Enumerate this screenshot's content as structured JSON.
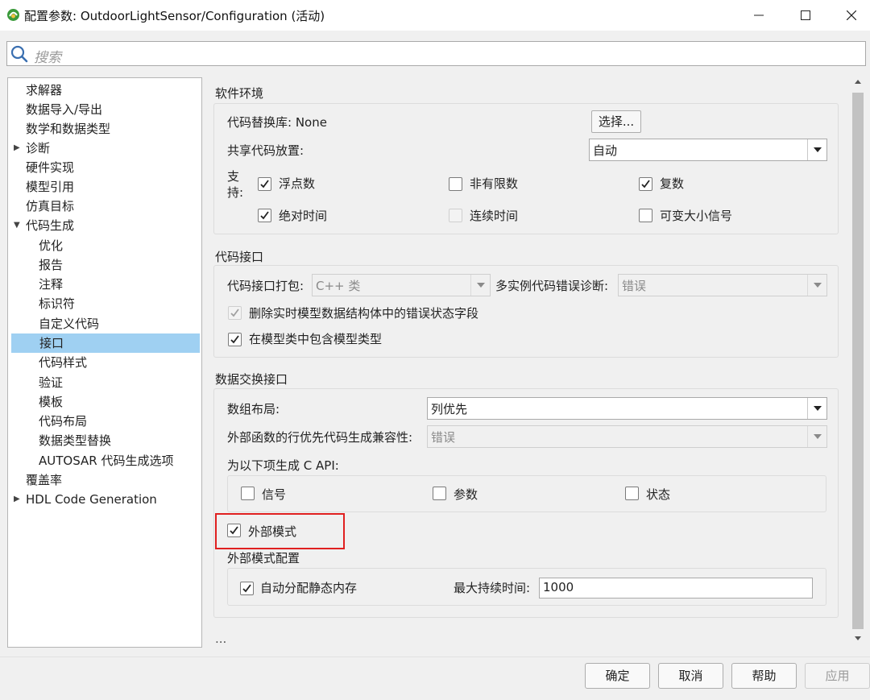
{
  "window": {
    "title": "配置参数: OutdoorLightSensor/Configuration (活动)"
  },
  "search": {
    "placeholder": "搜索"
  },
  "tree": {
    "items": [
      {
        "label": "求解器"
      },
      {
        "label": "数据导入/导出"
      },
      {
        "label": "数学和数据类型"
      },
      {
        "label": "诊断",
        "expand": "collapsed"
      },
      {
        "label": "硬件实现"
      },
      {
        "label": "模型引用"
      },
      {
        "label": "仿真目标"
      },
      {
        "label": "代码生成",
        "expand": "expanded"
      },
      {
        "label": "优化"
      },
      {
        "label": "报告"
      },
      {
        "label": "注释"
      },
      {
        "label": "标识符"
      },
      {
        "label": "自定义代码"
      },
      {
        "label": "接口",
        "selected": true
      },
      {
        "label": "代码样式"
      },
      {
        "label": "验证"
      },
      {
        "label": "模板"
      },
      {
        "label": "代码布局"
      },
      {
        "label": "数据类型替换"
      },
      {
        "label": "AUTOSAR 代码生成选项"
      },
      {
        "label": "覆盖率"
      },
      {
        "label": "HDL Code Generation",
        "expand": "collapsed"
      }
    ]
  },
  "software_env": {
    "title": "软件环境",
    "code_replacement_label": "代码替换库: None",
    "select_button": "选择...",
    "shared_code_label": "共享代码放置:",
    "shared_code_value": "自动",
    "support_label_1": "支",
    "support_label_2": "持:",
    "float_label": "浮点数",
    "float_checked": true,
    "nonfinite_label": "非有限数",
    "nonfinite_checked": false,
    "complex_label": "复数",
    "complex_checked": true,
    "abstime_label": "绝对时间",
    "abstime_checked": true,
    "conttime_label": "连续时间",
    "conttime_checked": false,
    "varsize_label": "可变大小信号",
    "varsize_checked": false
  },
  "code_interface": {
    "title": "代码接口",
    "packaging_label": "代码接口打包:",
    "packaging_value": "C++ 类",
    "multi_instance_label": "多实例代码错误诊断:",
    "multi_instance_value": "错误",
    "remove_error_label": "删除实时模型数据结构体中的错误状态字段",
    "remove_error_checked": true,
    "include_model_types_label": "在模型类中包含模型类型",
    "include_model_types_checked": true
  },
  "data_exchange": {
    "title": "数据交换接口",
    "array_layout_label": "数组布局:",
    "array_layout_value": "列优先",
    "row_major_label": "外部函数的行优先代码生成兼容性:",
    "row_major_value": "错误",
    "c_api_label": "为以下项生成 C API:",
    "signals_label": "信号",
    "signals_checked": false,
    "params_label": "参数",
    "params_checked": false,
    "states_label": "状态",
    "states_checked": false,
    "external_mode_label": "外部模式",
    "external_mode_checked": true,
    "ext_config_title": "外部模式配置",
    "static_mem_label": "自动分配静态内存",
    "static_mem_checked": true,
    "max_duration_label": "最大持续时间:",
    "max_duration_value": "1000"
  },
  "more": "...",
  "buttons": {
    "ok": "确定",
    "cancel": "取消",
    "help": "帮助",
    "apply": "应用"
  },
  "colors": {
    "selection": "#9fd0f2",
    "highlight": "#e02020"
  }
}
